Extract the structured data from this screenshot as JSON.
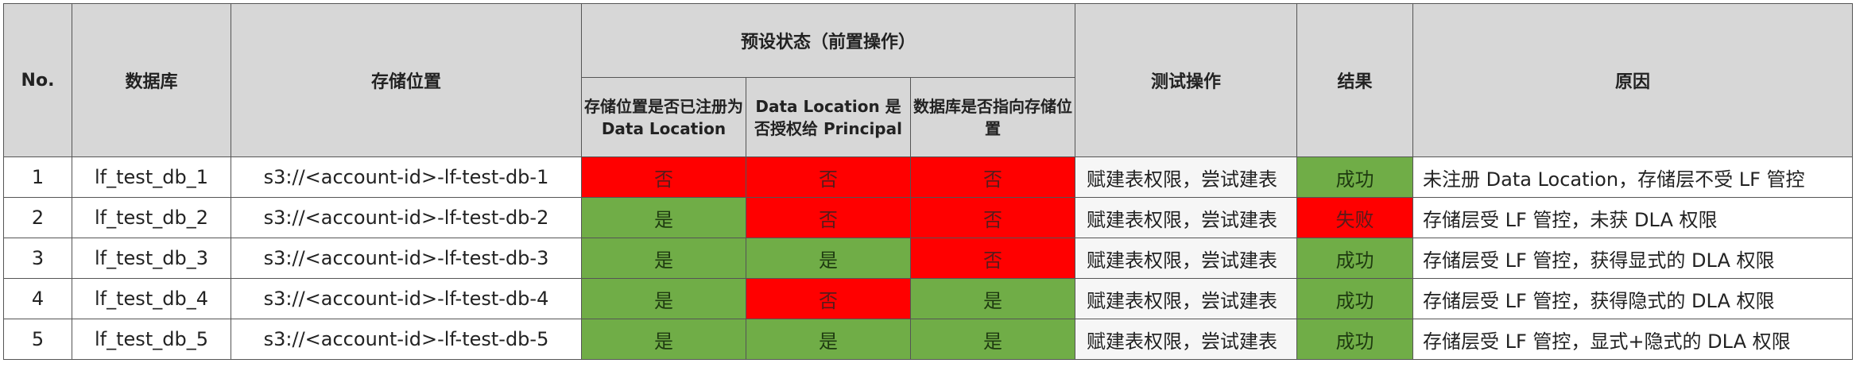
{
  "headers": {
    "no": "No.",
    "database": "数据库",
    "location": "存储位置",
    "preset_group": "预设状态（前置操作）",
    "preset_registered": "存储位置是否已注册为Data Location",
    "preset_granted": "Data Location 是否授权给 Principal",
    "preset_db_points": "数据库是否指向存储位置",
    "test_op": "测试操作",
    "result": "结果",
    "reason": "原因"
  },
  "rows": [
    {
      "no": "1",
      "database": "lf_test_db_1",
      "location": "s3://<account-id>-lf-test-db-1",
      "registered": "否",
      "granted": "否",
      "db_points": "否",
      "test_op": "赋建表权限，尝试建表",
      "result": "成功",
      "reason": "未注册 Data Location，存储层不受 LF 管控"
    },
    {
      "no": "2",
      "database": "lf_test_db_2",
      "location": "s3://<account-id>-lf-test-db-2",
      "registered": "是",
      "granted": "否",
      "db_points": "否",
      "test_op": "赋建表权限，尝试建表",
      "result": "失败",
      "reason": "存储层受 LF 管控，未获 DLA 权限"
    },
    {
      "no": "3",
      "database": "lf_test_db_3",
      "location": "s3://<account-id>-lf-test-db-3",
      "registered": "是",
      "granted": "是",
      "db_points": "否",
      "test_op": "赋建表权限，尝试建表",
      "result": "成功",
      "reason": "存储层受 LF 管控，获得显式的 DLA 权限"
    },
    {
      "no": "4",
      "database": "lf_test_db_4",
      "location": "s3://<account-id>-lf-test-db-4",
      "registered": "是",
      "granted": "否",
      "db_points": "是",
      "test_op": "赋建表权限，尝试建表",
      "result": "成功",
      "reason": "存储层受 LF 管控，获得隐式的 DLA 权限"
    },
    {
      "no": "5",
      "database": "lf_test_db_5",
      "location": "s3://<account-id>-lf-test-db-5",
      "registered": "是",
      "granted": "是",
      "db_points": "是",
      "test_op": "赋建表权限，尝试建表",
      "result": "成功",
      "reason": "存储层受 LF 管控，显式+隐式的 DLA 权限"
    }
  ],
  "colors": {
    "yes": "#70ad47",
    "no": "#ff0000",
    "success": "#70ad47",
    "failure": "#ff0000",
    "header": "#d7d7d7"
  }
}
